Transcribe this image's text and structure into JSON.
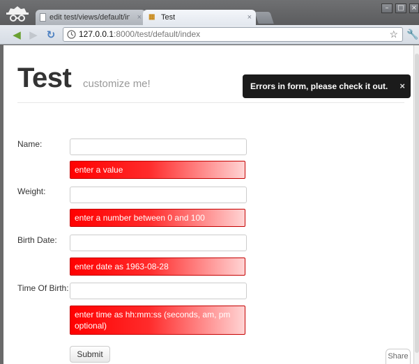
{
  "browser": {
    "tabs": [
      {
        "title": "edit test/views/default/inde",
        "close": "×"
      },
      {
        "title": "Test",
        "close": "×"
      }
    ],
    "url_host": "127.0.0.1",
    "url_rest": ":8000/test/default/index",
    "window_controls": [
      "–",
      "□",
      "×"
    ]
  },
  "page": {
    "title": "Test",
    "subtitle": "customize me!"
  },
  "flash": {
    "message": "Errors in form, please check it out.",
    "close": "×"
  },
  "form": {
    "fields": [
      {
        "label": "Name:",
        "value": "",
        "error": "enter a value"
      },
      {
        "label": "Weight:",
        "value": "",
        "error": "enter a number between 0 and 100"
      },
      {
        "label": "Birth Date:",
        "value": "",
        "error": "enter date as 1963-08-28"
      },
      {
        "label": "Time Of Birth:",
        "value": "",
        "error": "enter time as hh:mm:ss (seconds, am, pm optional)"
      }
    ],
    "submit_label": "Submit"
  },
  "share_label": "Share",
  "colors": {
    "error_red": "#ff0000",
    "flash_bg": "#1b1b1b"
  }
}
